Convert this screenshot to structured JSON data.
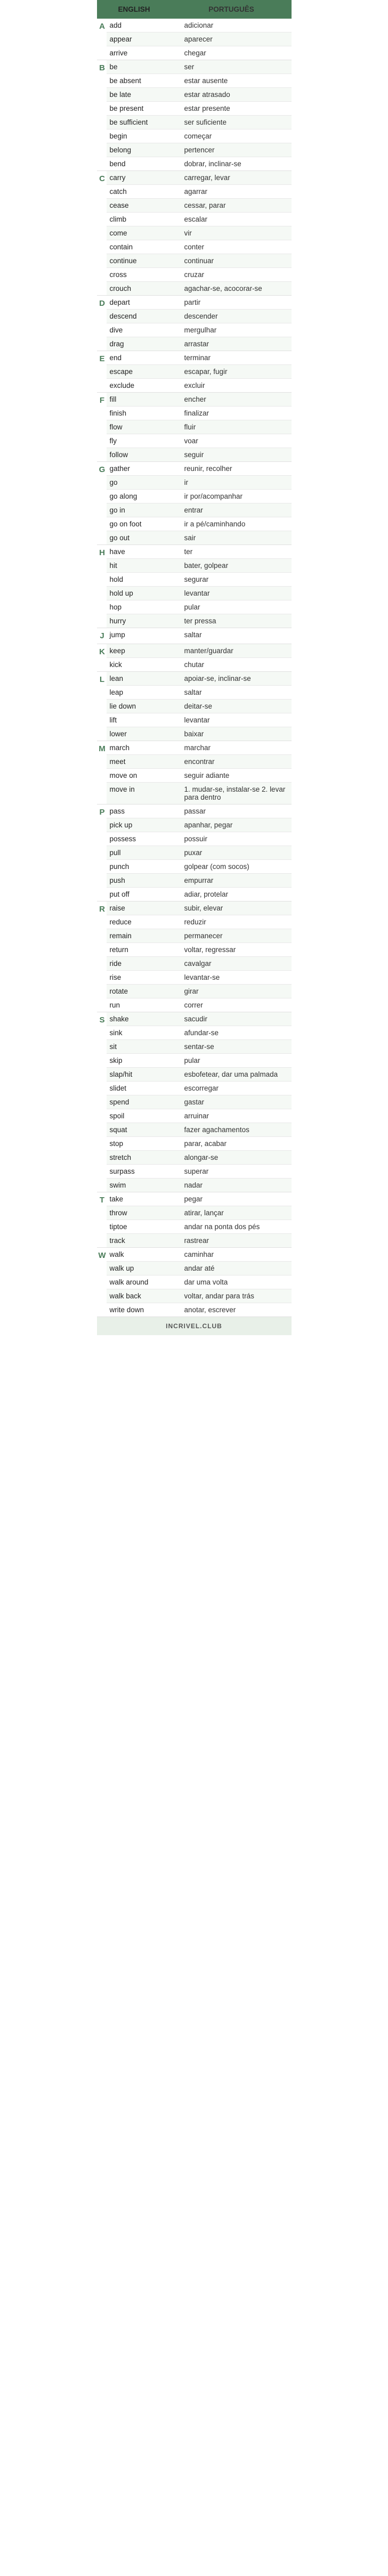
{
  "header": {
    "english": "ENGLISH",
    "portuguese": "PORTUGUÊS"
  },
  "sections": [
    {
      "letter": "A",
      "entries": [
        {
          "en": "add",
          "pt": "adicionar"
        },
        {
          "en": "appear",
          "pt": "aparecer"
        },
        {
          "en": "arrive",
          "pt": "chegar"
        }
      ]
    },
    {
      "letter": "B",
      "entries": [
        {
          "en": "be",
          "pt": "ser"
        },
        {
          "en": "be absent",
          "pt": "estar ausente"
        },
        {
          "en": "be late",
          "pt": "estar atrasado"
        },
        {
          "en": "be present",
          "pt": "estar presente"
        },
        {
          "en": "be sufficient",
          "pt": "ser suficiente"
        },
        {
          "en": "begin",
          "pt": "começar"
        },
        {
          "en": "belong",
          "pt": "pertencer"
        },
        {
          "en": "bend",
          "pt": "dobrar, inclinar-se"
        }
      ]
    },
    {
      "letter": "C",
      "entries": [
        {
          "en": "carry",
          "pt": "carregar, levar"
        },
        {
          "en": "catch",
          "pt": "agarrar"
        },
        {
          "en": "cease",
          "pt": "cessar, parar"
        },
        {
          "en": "climb",
          "pt": "escalar"
        },
        {
          "en": "come",
          "pt": "vir"
        },
        {
          "en": "contain",
          "pt": "conter"
        },
        {
          "en": "continue",
          "pt": "continuar"
        },
        {
          "en": "cross",
          "pt": "cruzar"
        },
        {
          "en": "crouch",
          "pt": "agachar-se, acocorar-se"
        }
      ]
    },
    {
      "letter": "D",
      "entries": [
        {
          "en": "depart",
          "pt": "partir"
        },
        {
          "en": "descend",
          "pt": "descender"
        },
        {
          "en": "dive",
          "pt": "mergulhar"
        },
        {
          "en": "drag",
          "pt": "arrastar"
        }
      ]
    },
    {
      "letter": "E",
      "entries": [
        {
          "en": "end",
          "pt": "terminar"
        },
        {
          "en": "escape",
          "pt": "escapar, fugir"
        },
        {
          "en": "exclude",
          "pt": "excluir"
        }
      ]
    },
    {
      "letter": "F",
      "entries": [
        {
          "en": "fill",
          "pt": "encher"
        },
        {
          "en": "finish",
          "pt": "finalizar"
        },
        {
          "en": "flow",
          "pt": "fluir"
        },
        {
          "en": "fly",
          "pt": "voar"
        },
        {
          "en": "follow",
          "pt": "seguir"
        }
      ]
    },
    {
      "letter": "G",
      "entries": [
        {
          "en": "gather",
          "pt": "reunir, recolher"
        },
        {
          "en": "go",
          "pt": "ir"
        },
        {
          "en": "go along",
          "pt": "ir por/acompanhar"
        },
        {
          "en": "go in",
          "pt": "entrar"
        },
        {
          "en": "go on foot",
          "pt": "ir a pé/caminhando"
        },
        {
          "en": "go out",
          "pt": "sair"
        }
      ]
    },
    {
      "letter": "H",
      "entries": [
        {
          "en": "have",
          "pt": "ter"
        },
        {
          "en": "hit",
          "pt": "bater, golpear"
        },
        {
          "en": "hold",
          "pt": "segurar"
        },
        {
          "en": "hold up",
          "pt": "levantar"
        },
        {
          "en": "hop",
          "pt": "pular"
        },
        {
          "en": "hurry",
          "pt": "ter pressa"
        }
      ]
    },
    {
      "letter": "J",
      "entries": [
        {
          "en": "jump",
          "pt": "saltar"
        }
      ]
    },
    {
      "letter": "K",
      "entries": [
        {
          "en": "keep",
          "pt": "manter/guardar"
        },
        {
          "en": "kick",
          "pt": "chutar"
        }
      ]
    },
    {
      "letter": "L",
      "entries": [
        {
          "en": "lean",
          "pt": "apoiar-se, inclinar-se"
        },
        {
          "en": "leap",
          "pt": "saltar"
        },
        {
          "en": "lie down",
          "pt": "deitar-se"
        },
        {
          "en": "lift",
          "pt": "levantar"
        },
        {
          "en": "lower",
          "pt": "baixar"
        }
      ]
    },
    {
      "letter": "M",
      "entries": [
        {
          "en": "march",
          "pt": "marchar"
        },
        {
          "en": "meet",
          "pt": "encontrar"
        },
        {
          "en": "move on",
          "pt": "seguir adiante"
        },
        {
          "en": "move in",
          "pt": "1. mudar-se, instalar-se\n2. levar para dentro"
        }
      ]
    },
    {
      "letter": "P",
      "entries": [
        {
          "en": "pass",
          "pt": "passar"
        },
        {
          "en": "pick up",
          "pt": "apanhar, pegar"
        },
        {
          "en": "possess",
          "pt": "possuir"
        },
        {
          "en": "pull",
          "pt": "puxar"
        },
        {
          "en": "punch",
          "pt": "golpear (com socos)"
        },
        {
          "en": "push",
          "pt": "empurrar"
        },
        {
          "en": "put off",
          "pt": "adiar, protelar"
        }
      ]
    },
    {
      "letter": "R",
      "entries": [
        {
          "en": "raise",
          "pt": "subir, elevar"
        },
        {
          "en": "reduce",
          "pt": "reduzir"
        },
        {
          "en": "remain",
          "pt": "permanecer"
        },
        {
          "en": "return",
          "pt": "voltar, regressar"
        },
        {
          "en": "ride",
          "pt": "cavalgar"
        },
        {
          "en": "rise",
          "pt": "levantar-se"
        },
        {
          "en": "rotate",
          "pt": "girar"
        },
        {
          "en": "run",
          "pt": "correr"
        }
      ]
    },
    {
      "letter": "S",
      "entries": [
        {
          "en": "shake",
          "pt": "sacudir"
        },
        {
          "en": "sink",
          "pt": "afundar-se"
        },
        {
          "en": "sit",
          "pt": "sentar-se"
        },
        {
          "en": "skip",
          "pt": "pular"
        },
        {
          "en": "slap/hit",
          "pt": "esbofetear,\ndar uma palmada"
        },
        {
          "en": "slidet",
          "pt": "escorregar"
        },
        {
          "en": "spend",
          "pt": "gastar"
        },
        {
          "en": "spoil",
          "pt": "arruinar"
        },
        {
          "en": "squat",
          "pt": "fazer agachamentos"
        },
        {
          "en": "stop",
          "pt": "parar, acabar"
        },
        {
          "en": "stretch",
          "pt": "alongar-se"
        },
        {
          "en": "surpass",
          "pt": "superar"
        },
        {
          "en": "swim",
          "pt": "nadar"
        }
      ]
    },
    {
      "letter": "T",
      "entries": [
        {
          "en": "take",
          "pt": "pegar"
        },
        {
          "en": "throw",
          "pt": "atirar, lançar"
        },
        {
          "en": "tiptoe",
          "pt": "andar na ponta dos pés"
        },
        {
          "en": "track",
          "pt": "rastrear"
        }
      ]
    },
    {
      "letter": "W",
      "entries": [
        {
          "en": "walk",
          "pt": "caminhar"
        },
        {
          "en": "walk up",
          "pt": "andar até"
        },
        {
          "en": "walk around",
          "pt": "dar uma volta"
        },
        {
          "en": "walk back",
          "pt": "voltar,\nandar para trás"
        },
        {
          "en": "write down",
          "pt": "anotar, escrever"
        }
      ]
    }
  ],
  "footer": "INCRIVEL.CLUB"
}
